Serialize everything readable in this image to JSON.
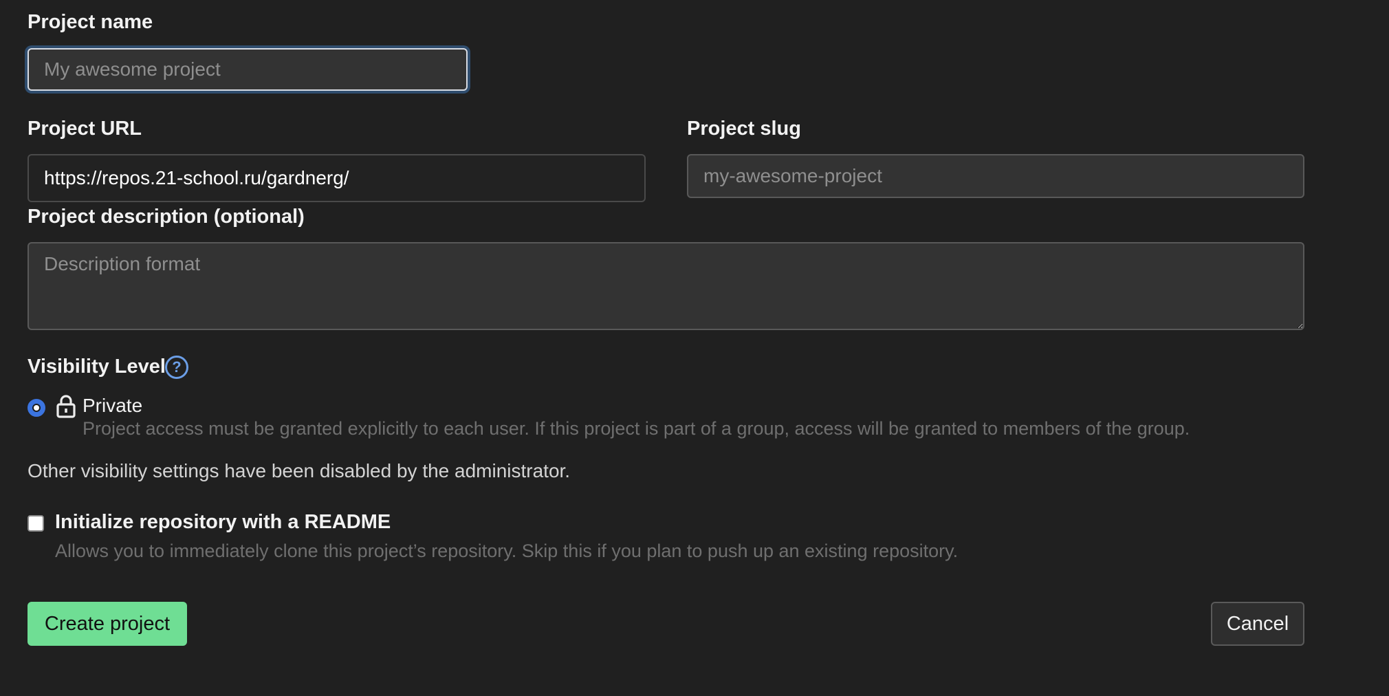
{
  "form": {
    "project_name": {
      "label": "Project name",
      "placeholder": "My awesome project",
      "value": ""
    },
    "project_url": {
      "label": "Project URL",
      "value": "https://repos.21-school.ru/gardnerg/"
    },
    "project_slug": {
      "label": "Project slug",
      "placeholder": "my-awesome-project",
      "value": ""
    },
    "project_description": {
      "label": "Project description (optional)",
      "placeholder": "Description format",
      "value": ""
    },
    "visibility": {
      "label": "Visibility Level",
      "help_icon": "question-circle-icon",
      "options": [
        {
          "label": "Private",
          "icon": "lock-icon",
          "selected": true,
          "description": "Project access must be granted explicitly to each user. If this project is part of a group, access will be granted to members of the group."
        }
      ],
      "disabled_note": "Other visibility settings have been disabled by the administrator."
    },
    "readme": {
      "label": "Initialize repository with a README",
      "checked": false,
      "description": "Allows you to immediately clone this project’s repository. Skip this if you plan to push up an existing repository."
    },
    "actions": {
      "create_label": "Create project",
      "cancel_label": "Cancel"
    }
  },
  "colors": {
    "background": "#202020",
    "primary_button": "#6fde94",
    "radio_accent": "#3b74e0",
    "help_icon": "#6b9ee6"
  }
}
